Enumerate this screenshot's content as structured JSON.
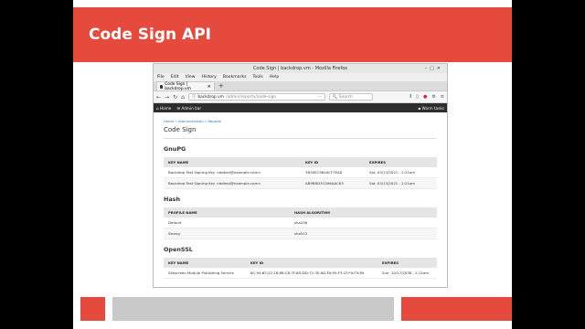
{
  "slide": {
    "title": "Code Sign API"
  },
  "browser": {
    "window_title": "Code Sign | backdrop.vm - Mozilla Firefox",
    "menu": [
      "File",
      "Edit",
      "View",
      "History",
      "Bookmarks",
      "Tools",
      "Help"
    ],
    "tab_label": "Code Sign | backdrop.vm",
    "url_host": "backdrop.vm",
    "url_path": "/admin/reports/code-sign",
    "search_placeholder": "Search"
  },
  "admin_bar": {
    "home": "Home",
    "admin": "Admin bar",
    "right": "Warm tasks"
  },
  "page": {
    "breadcrumb": "Home » Administration » Reports",
    "title": "Code Sign",
    "gnupg": {
      "heading": "GnuPG",
      "headers": [
        "KEY NAME",
        "KEY ID",
        "EXPIRES"
      ],
      "rows": [
        [
          "Backdrop Test Signing Key <bdtest@example.com>",
          "3B30EC9640CF7EA0",
          "Sat, 03/13/2021 - 2:21am"
        ],
        [
          "Backdrop Test Signing Key <bdtest@example.com>",
          "AB9BBD3C096AAC63",
          "Sat, 03/13/2021 - 2:21am"
        ]
      ]
    },
    "hash": {
      "heading": "Hash",
      "headers": [
        "PROFILE NAME",
        "HASH ALGORITHM"
      ],
      "rows": [
        [
          "Default",
          "sha256"
        ],
        [
          "Strong",
          "sha512"
        ]
      ]
    },
    "openssl": {
      "heading": "OpenSSL",
      "headers": [
        "KEY NAME",
        "KEY ID",
        "EXPIRES"
      ],
      "rows": [
        [
          "Silkscreen Module Publishing Service",
          "6C:94:65:22:18:88:C8:7F:6D:DD:71:3E:AD:FA:95:F3:1F:F0:F5:89",
          "Sun, 10/17/2038 - 2:11am"
        ]
      ]
    }
  }
}
